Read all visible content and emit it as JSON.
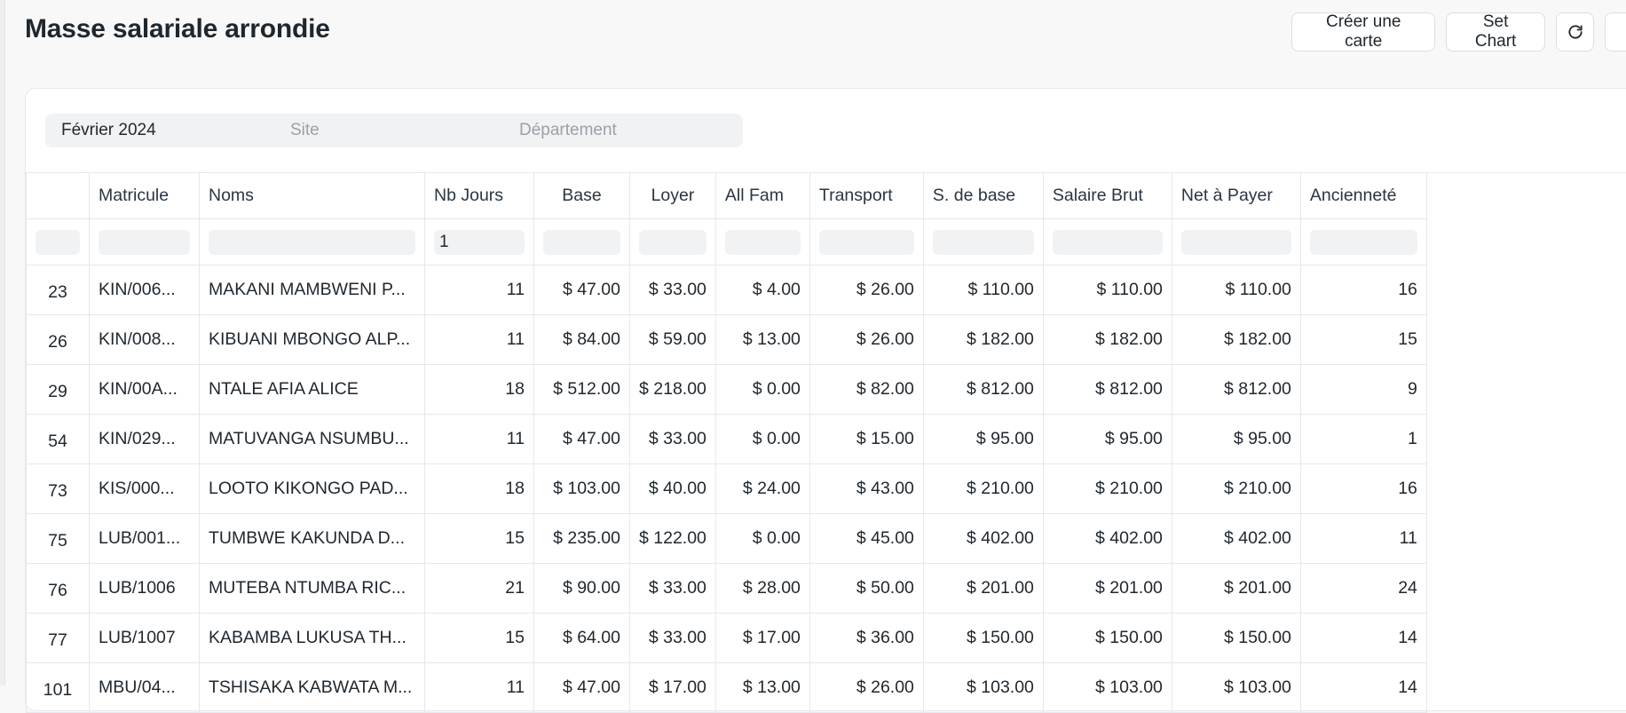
{
  "header": {
    "title": "Masse salariale arrondie",
    "buttons": {
      "create_card": "Créer une carte",
      "set_chart": "Set Chart"
    }
  },
  "filters": {
    "period": "Février 2024",
    "site_placeholder": "Site",
    "department_placeholder": "Département"
  },
  "table": {
    "columns": [
      "",
      "Matricule",
      "Noms",
      "Nb Jours",
      "Base",
      "Loyer",
      "All Fam",
      "Transport",
      "S. de base",
      "Salaire Brut",
      "Net à Payer",
      "Ancienneté"
    ],
    "filter_values": [
      "",
      "",
      "",
      "1",
      "",
      "",
      "",
      "",
      "",
      "",
      "",
      ""
    ],
    "rows": [
      [
        "23",
        "KIN/006...",
        "MAKANI MAMBWENI P...",
        "11",
        "$ 47.00",
        "$ 33.00",
        "$ 4.00",
        "$ 26.00",
        "$ 110.00",
        "$ 110.00",
        "$ 110.00",
        "16"
      ],
      [
        "26",
        "KIN/008...",
        "KIBUANI MBONGO ALP...",
        "11",
        "$ 84.00",
        "$ 59.00",
        "$ 13.00",
        "$ 26.00",
        "$ 182.00",
        "$ 182.00",
        "$ 182.00",
        "15"
      ],
      [
        "29",
        "KIN/00A...",
        "NTALE AFIA ALICE",
        "18",
        "$ 512.00",
        "$ 218.00",
        "$ 0.00",
        "$ 82.00",
        "$ 812.00",
        "$ 812.00",
        "$ 812.00",
        "9"
      ],
      [
        "54",
        "KIN/029...",
        "MATUVANGA NSUMBU...",
        "11",
        "$ 47.00",
        "$ 33.00",
        "$ 0.00",
        "$ 15.00",
        "$ 95.00",
        "$ 95.00",
        "$ 95.00",
        "1"
      ],
      [
        "73",
        "KIS/000...",
        "LOOTO KIKONGO PAD...",
        "18",
        "$ 103.00",
        "$ 40.00",
        "$ 24.00",
        "$ 43.00",
        "$ 210.00",
        "$ 210.00",
        "$ 210.00",
        "16"
      ],
      [
        "75",
        "LUB/001...",
        "TUMBWE KAKUNDA D...",
        "15",
        "$ 235.00",
        "$ 122.00",
        "$ 0.00",
        "$ 45.00",
        "$ 402.00",
        "$ 402.00",
        "$ 402.00",
        "11"
      ],
      [
        "76",
        "LUB/1006",
        "MUTEBA NTUMBA RIC...",
        "21",
        "$ 90.00",
        "$ 33.00",
        "$ 28.00",
        "$ 50.00",
        "$ 201.00",
        "$ 201.00",
        "$ 201.00",
        "24"
      ],
      [
        "77",
        "LUB/1007",
        "KABAMBA LUKUSA TH...",
        "15",
        "$ 64.00",
        "$ 33.00",
        "$ 17.00",
        "$ 36.00",
        "$ 150.00",
        "$ 150.00",
        "$ 150.00",
        "14"
      ],
      [
        "101",
        "MBU/04...",
        "TSHISAKA KABWATA M...",
        "11",
        "$ 47.00",
        "$ 17.00",
        "$ 13.00",
        "$ 26.00",
        "$ 103.00",
        "$ 103.00",
        "$ 103.00",
        "14"
      ]
    ]
  }
}
